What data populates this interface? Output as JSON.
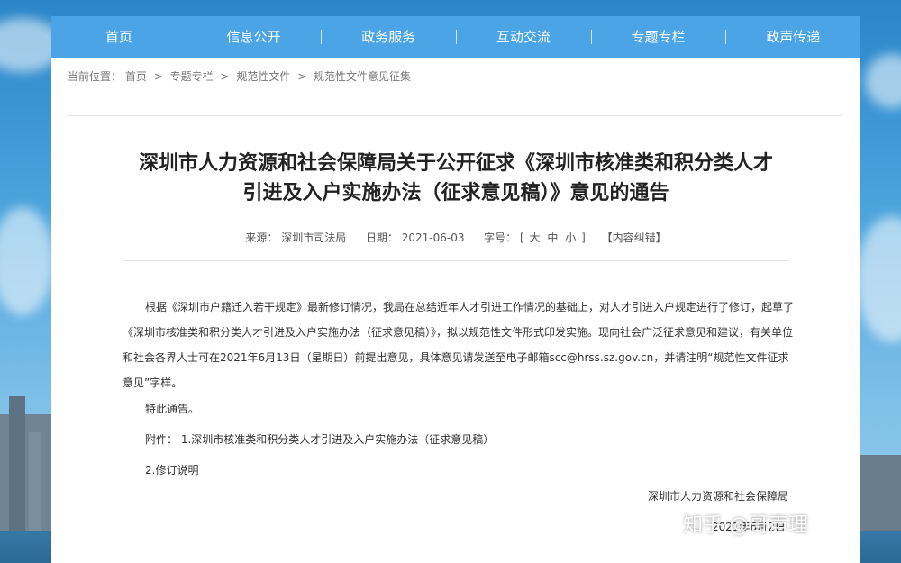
{
  "nav": {
    "items": [
      "首页",
      "信息公开",
      "政务服务",
      "互动交流",
      "专题专栏",
      "政声传递"
    ]
  },
  "breadcrumb": {
    "prefix": "当前位置：",
    "items": [
      "首页",
      "专题专栏",
      "规范性文件",
      "规范性文件意见征集"
    ],
    "separator": ">"
  },
  "article": {
    "title_line1": "深圳市人力资源和社会保障局关于公开征求《深圳市核准类和积分类人才",
    "title_line2": "引进及入户实施办法（征求意见稿）》意见的通告",
    "source_label": "来源：",
    "source": "深圳市司法局",
    "date_label": "日期：",
    "date": "2021-06-03",
    "fontsize_label": "字号：",
    "fontsize_open": "[",
    "fontsize_large": "大",
    "fontsize_medium": "中",
    "fontsize_small": "小",
    "fontsize_close": "]",
    "error_link": "【内容纠错】",
    "body": "根据《深圳市户籍迁入若干规定》最新修订情况，我局在总结近年人才引进工作情况的基础上，对人才引进入户规定进行了修订，起草了《深圳市核准类和积分类人才引进及入户实施办法（征求意见稿）》，拟以规范性文件形式印发实施。现向社会广泛征求意见和建议，有关单位和社会各界人士可在2021年6月13日（星期日）前提出意见，具体意见请发送至电子邮箱scc@hrss.sz.gov.cn，并请注明“规范性文件征求意见”字样。",
    "notice": "特此通告。",
    "attachment_label": "附件：",
    "attachment_1": "1.深圳市核准类和积分类人才引进及入户实施办法（征求意见稿）",
    "attachment_2": "2.修订说明",
    "signature": "深圳市人力资源和社会保障局",
    "sign_date": "2021年6月2日"
  },
  "watermark": "知乎 @哥声理",
  "colors": {
    "nav_bg": "#4aa4e6",
    "nav_text": "#ffffff",
    "title": "#222222",
    "body_text": "#333333"
  }
}
